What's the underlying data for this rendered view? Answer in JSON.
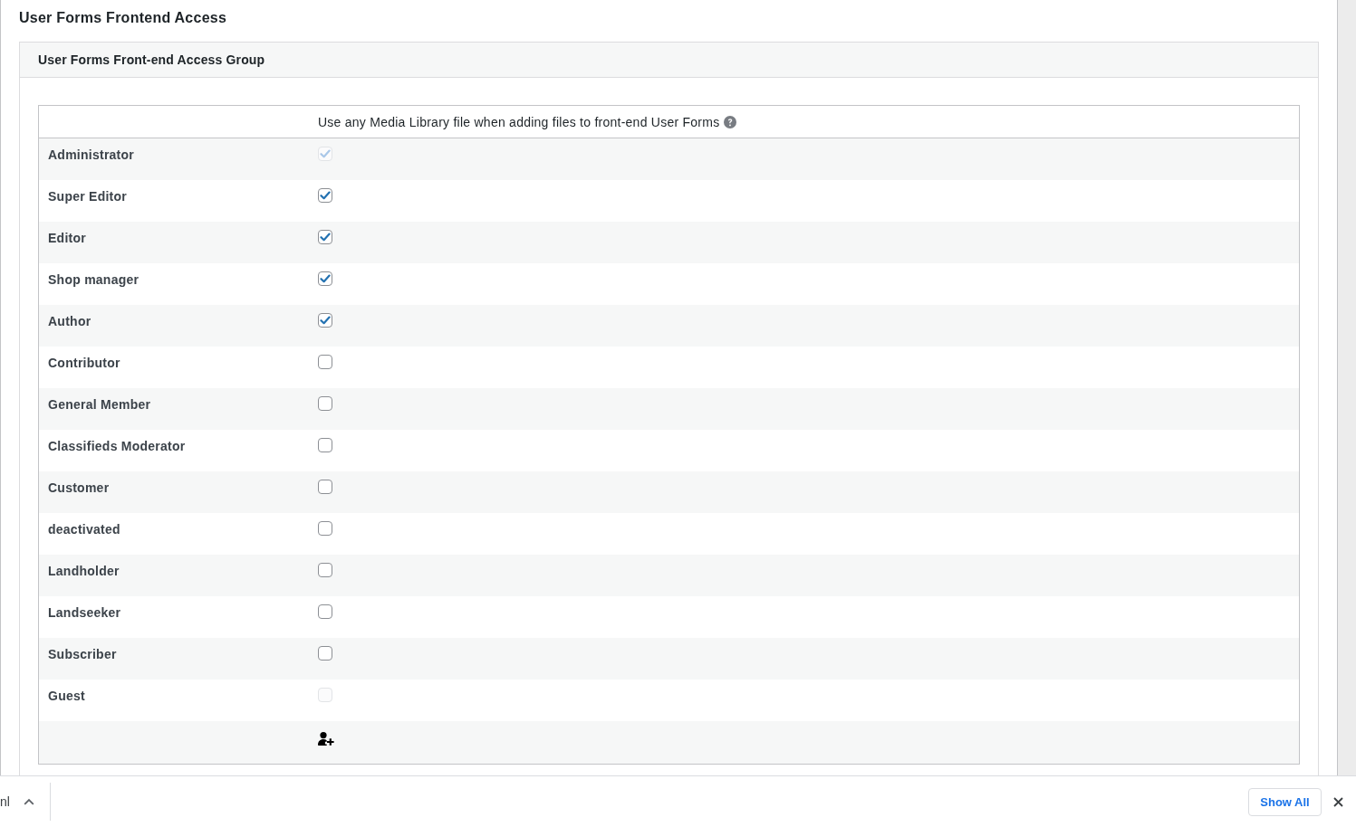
{
  "page": {
    "title": "User Forms Frontend Access"
  },
  "group": {
    "title": "User Forms Front-end Access Group",
    "table": {
      "columns": [
        {
          "label": "Use any Media Library file when adding files to front-end User Forms",
          "help": true
        }
      ],
      "rows": [
        {
          "role": "Administrator",
          "checked": true,
          "disabled": true
        },
        {
          "role": "Super Editor",
          "checked": true,
          "disabled": false
        },
        {
          "role": "Editor",
          "checked": true,
          "disabled": false
        },
        {
          "role": "Shop manager",
          "checked": true,
          "disabled": false
        },
        {
          "role": "Author",
          "checked": true,
          "disabled": false
        },
        {
          "role": "Contributor",
          "checked": false,
          "disabled": false
        },
        {
          "role": "General Member",
          "checked": false,
          "disabled": false
        },
        {
          "role": "Classifieds Moderator",
          "checked": false,
          "disabled": false
        },
        {
          "role": "Customer",
          "checked": false,
          "disabled": false
        },
        {
          "role": "deactivated",
          "checked": false,
          "disabled": false
        },
        {
          "role": "Landholder",
          "checked": false,
          "disabled": false
        },
        {
          "role": "Landseeker",
          "checked": false,
          "disabled": false
        },
        {
          "role": "Subscriber",
          "checked": false,
          "disabled": false
        },
        {
          "role": "Guest",
          "checked": false,
          "disabled": true
        }
      ]
    }
  },
  "download_bar": {
    "file_name": "nl",
    "buttons": [
      "Show All"
    ]
  }
}
